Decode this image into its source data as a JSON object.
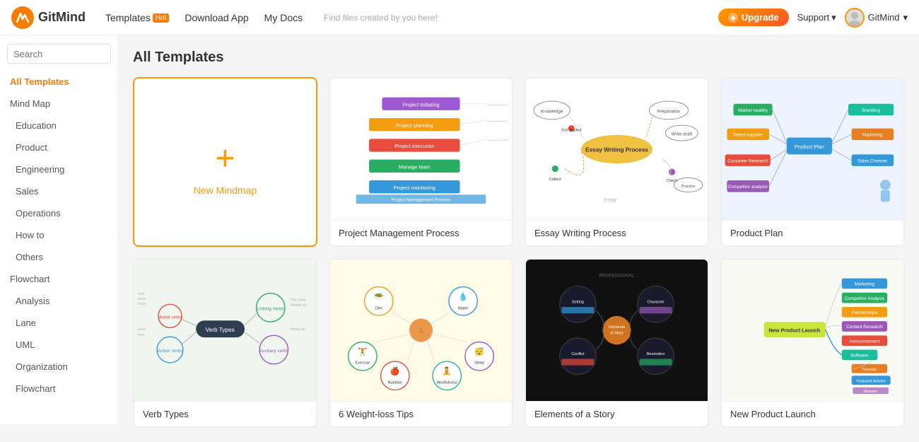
{
  "header": {
    "logo_text": "GitMind",
    "nav": [
      {
        "label": "Templates",
        "hot": true
      },
      {
        "label": "Download App",
        "hot": false
      },
      {
        "label": "My Docs",
        "hot": false
      }
    ],
    "find_hint": "Find files created by you here!",
    "upgrade_label": "Upgrade",
    "support_label": "Support",
    "user_label": "GitMind"
  },
  "sidebar": {
    "search_placeholder": "Search",
    "items": [
      {
        "label": "All Templates",
        "active": true,
        "type": "category"
      },
      {
        "label": "Mind Map",
        "active": false,
        "type": "category"
      },
      {
        "label": "Education",
        "active": false,
        "type": "sub"
      },
      {
        "label": "Product",
        "active": false,
        "type": "sub"
      },
      {
        "label": "Engineering",
        "active": false,
        "type": "sub"
      },
      {
        "label": "Sales",
        "active": false,
        "type": "sub"
      },
      {
        "label": "Operations",
        "active": false,
        "type": "sub"
      },
      {
        "label": "How to",
        "active": false,
        "type": "sub"
      },
      {
        "label": "Others",
        "active": false,
        "type": "sub"
      },
      {
        "label": "Flowchart",
        "active": false,
        "type": "category"
      },
      {
        "label": "Analysis",
        "active": false,
        "type": "sub"
      },
      {
        "label": "Lane",
        "active": false,
        "type": "sub"
      },
      {
        "label": "UML",
        "active": false,
        "type": "sub"
      },
      {
        "label": "Organization",
        "active": false,
        "type": "sub"
      },
      {
        "label": "Flowchart",
        "active": false,
        "type": "sub"
      }
    ]
  },
  "main": {
    "page_title": "All Templates",
    "new_mindmap_label": "New Mindmap",
    "templates": [
      {
        "name": "Project Management Process",
        "thumb": "pm"
      },
      {
        "name": "Essay Writing Process",
        "thumb": "essay"
      },
      {
        "name": "Product Plan",
        "thumb": "product"
      },
      {
        "name": "Verb Types",
        "thumb": "verb"
      },
      {
        "name": "6 Weight-loss Tips",
        "thumb": "weight"
      },
      {
        "name": "Elements of a Story",
        "thumb": "story"
      },
      {
        "name": "New Product Launch",
        "thumb": "launch"
      }
    ]
  }
}
